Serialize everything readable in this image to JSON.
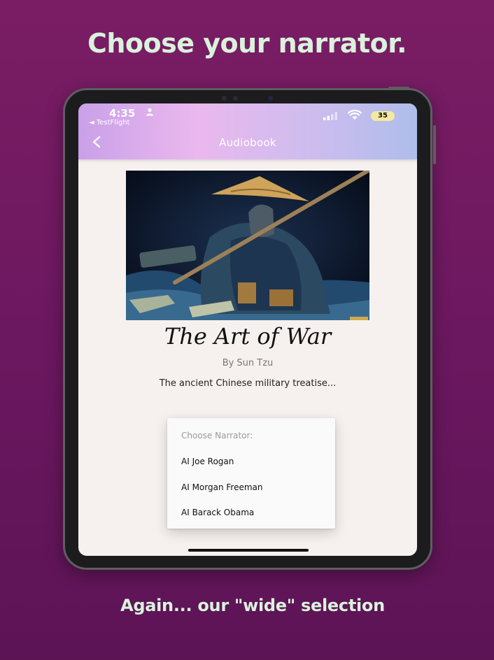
{
  "promo": {
    "headline": "Choose your narrator.",
    "caption": "Again... our \"wide\" selection"
  },
  "status_bar": {
    "time": "4:35",
    "back_app": "◄ TestFlight",
    "battery": "35"
  },
  "app_bar": {
    "back_icon": "chevron-left-icon",
    "title": "Audiobook"
  },
  "book": {
    "cover_art": "samurai-with-straw-hat-and-staff-illustration",
    "title": "The Art of War",
    "author": "By Sun Tzu",
    "description": "The ancient Chinese military treatise..."
  },
  "narrator_menu": {
    "header": "Choose Narrator:",
    "options": [
      "AI Joe Rogan",
      "AI Morgan Freeman",
      "AI Barack Obama"
    ]
  },
  "colors": {
    "background": "#6c1860",
    "headline_text": "#d9f2dc",
    "app_bar_gradient": [
      "#c9a0e8",
      "#eab8ee",
      "#aebdeb"
    ],
    "screen_background": "#f6f1ef"
  }
}
